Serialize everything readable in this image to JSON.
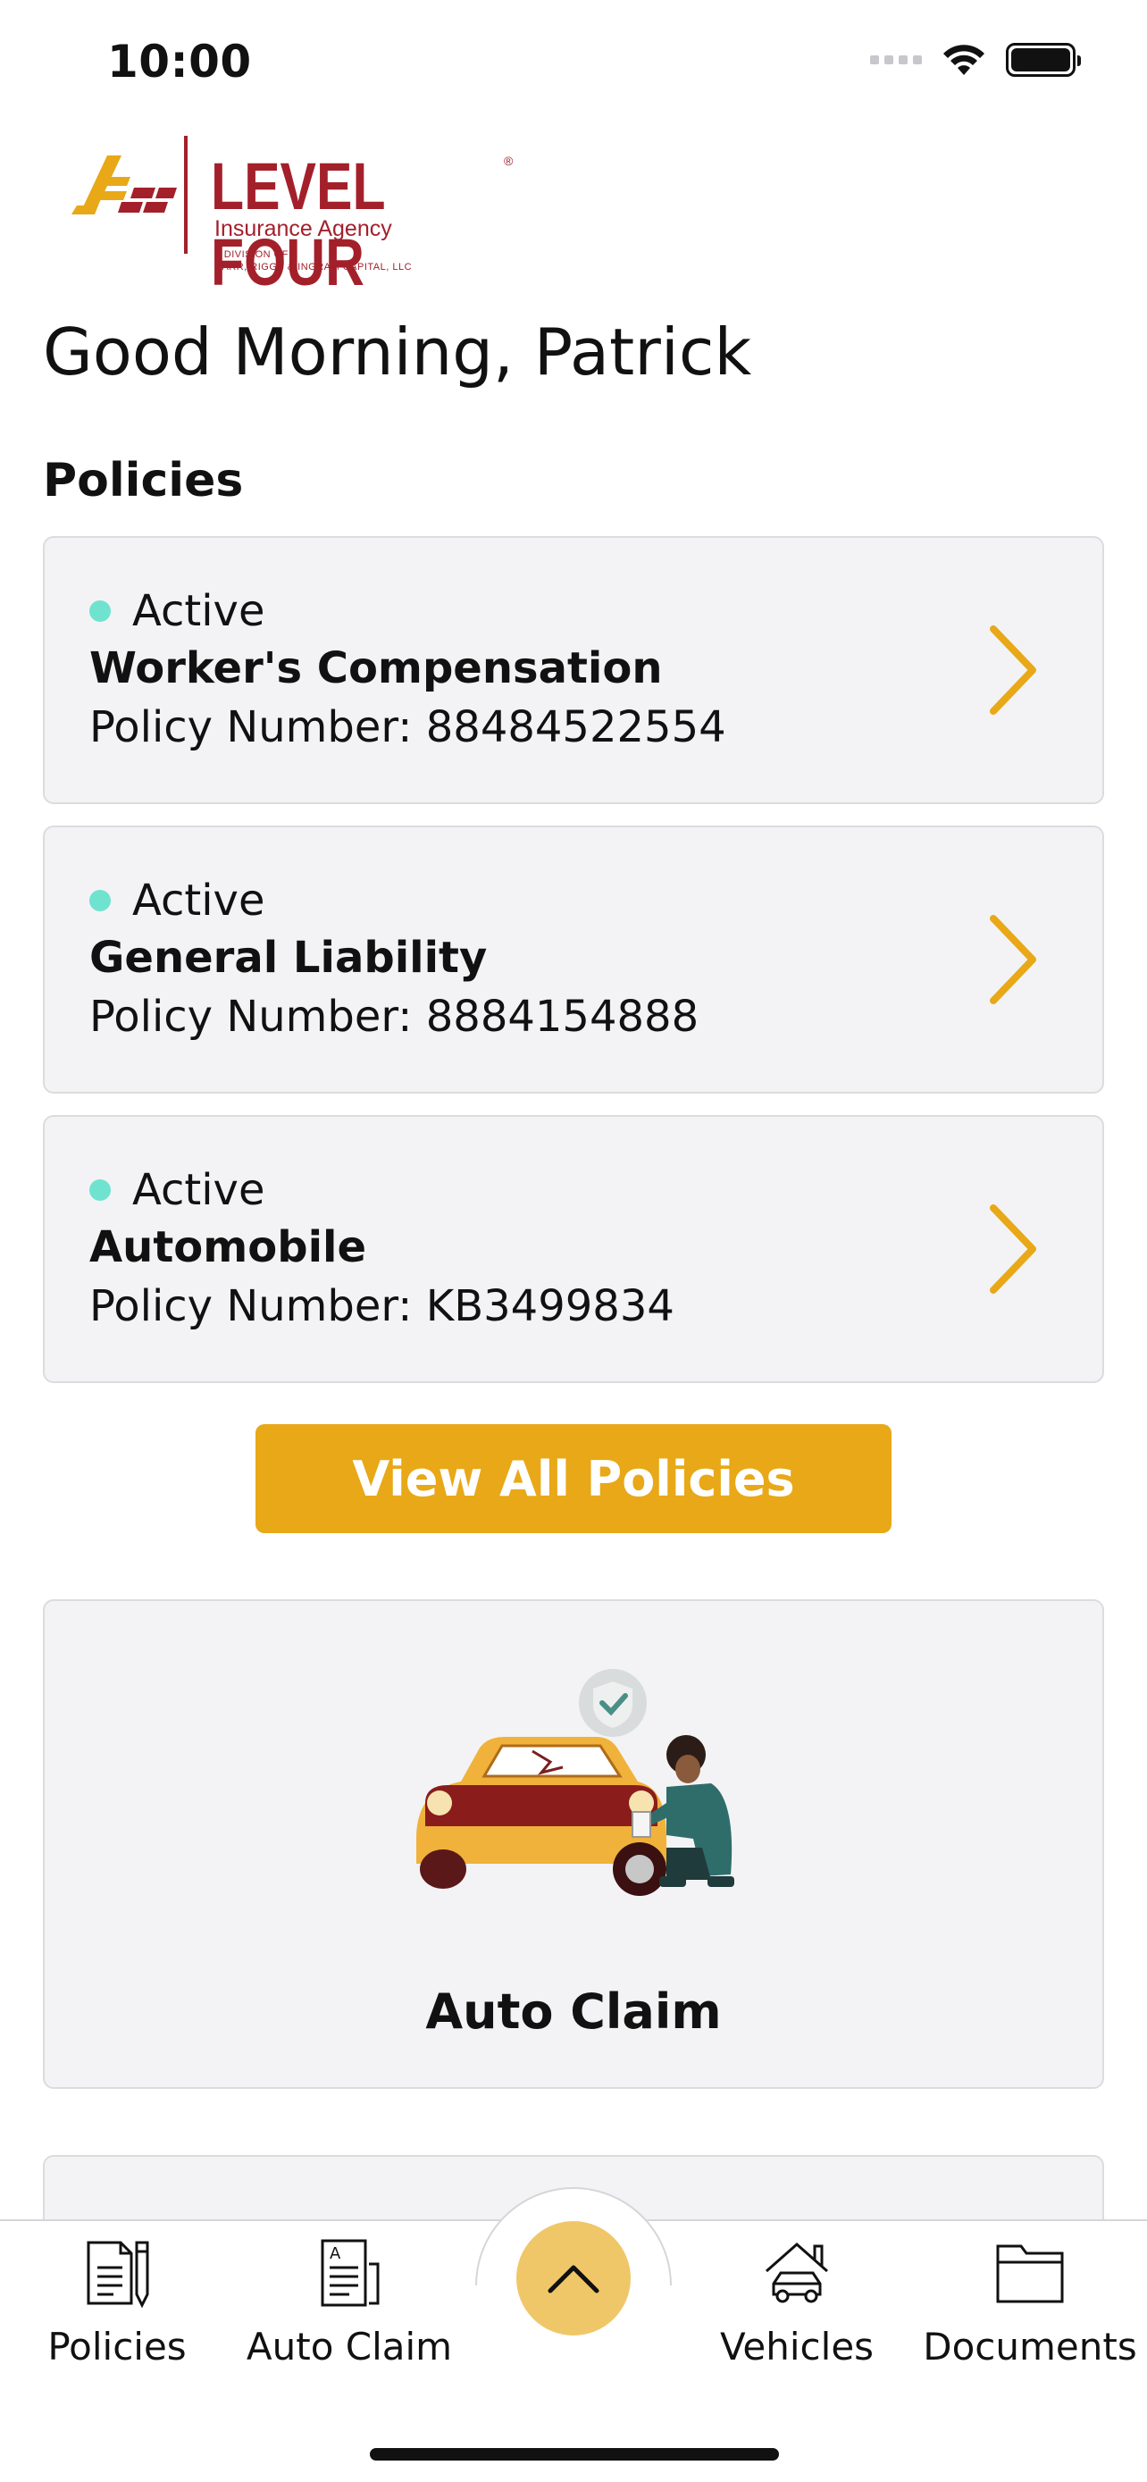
{
  "status_bar": {
    "time": "10:00"
  },
  "brand": {
    "name": "LEVEL FOUR",
    "subtitle": "Insurance Agency",
    "division_line1": "A DIVISION OF",
    "division_line2": "CARR, RIGGS & INGRAM CAPITAL, LLC",
    "color": "#a3202b",
    "accent": "#e8a817"
  },
  "greeting": "Good Morning, Patrick",
  "policies_section": {
    "title": "Policies",
    "items": [
      {
        "status": "Active",
        "name": "Worker's Compensation",
        "number": "Policy Number: 88484522554"
      },
      {
        "status": "Active",
        "name": "General Liability",
        "number": "Policy Number: 8884154888"
      },
      {
        "status": "Active",
        "name": "Automobile",
        "number": "Policy Number: KB3499834"
      }
    ],
    "view_all_label": "View All Policies"
  },
  "claim_card": {
    "label": "Auto Claim"
  },
  "tab_bar": {
    "items": [
      {
        "label": "Policies",
        "icon": "policies-icon"
      },
      {
        "label": "Auto Claim",
        "icon": "auto-claim-icon"
      },
      {
        "label": "Vehicles",
        "icon": "vehicles-icon"
      },
      {
        "label": "Documents",
        "icon": "documents-icon"
      }
    ],
    "center_icon": "chevron-up-icon"
  },
  "colors": {
    "status_active": "#6fe3cf",
    "card_bg": "#f3f3f5"
  }
}
